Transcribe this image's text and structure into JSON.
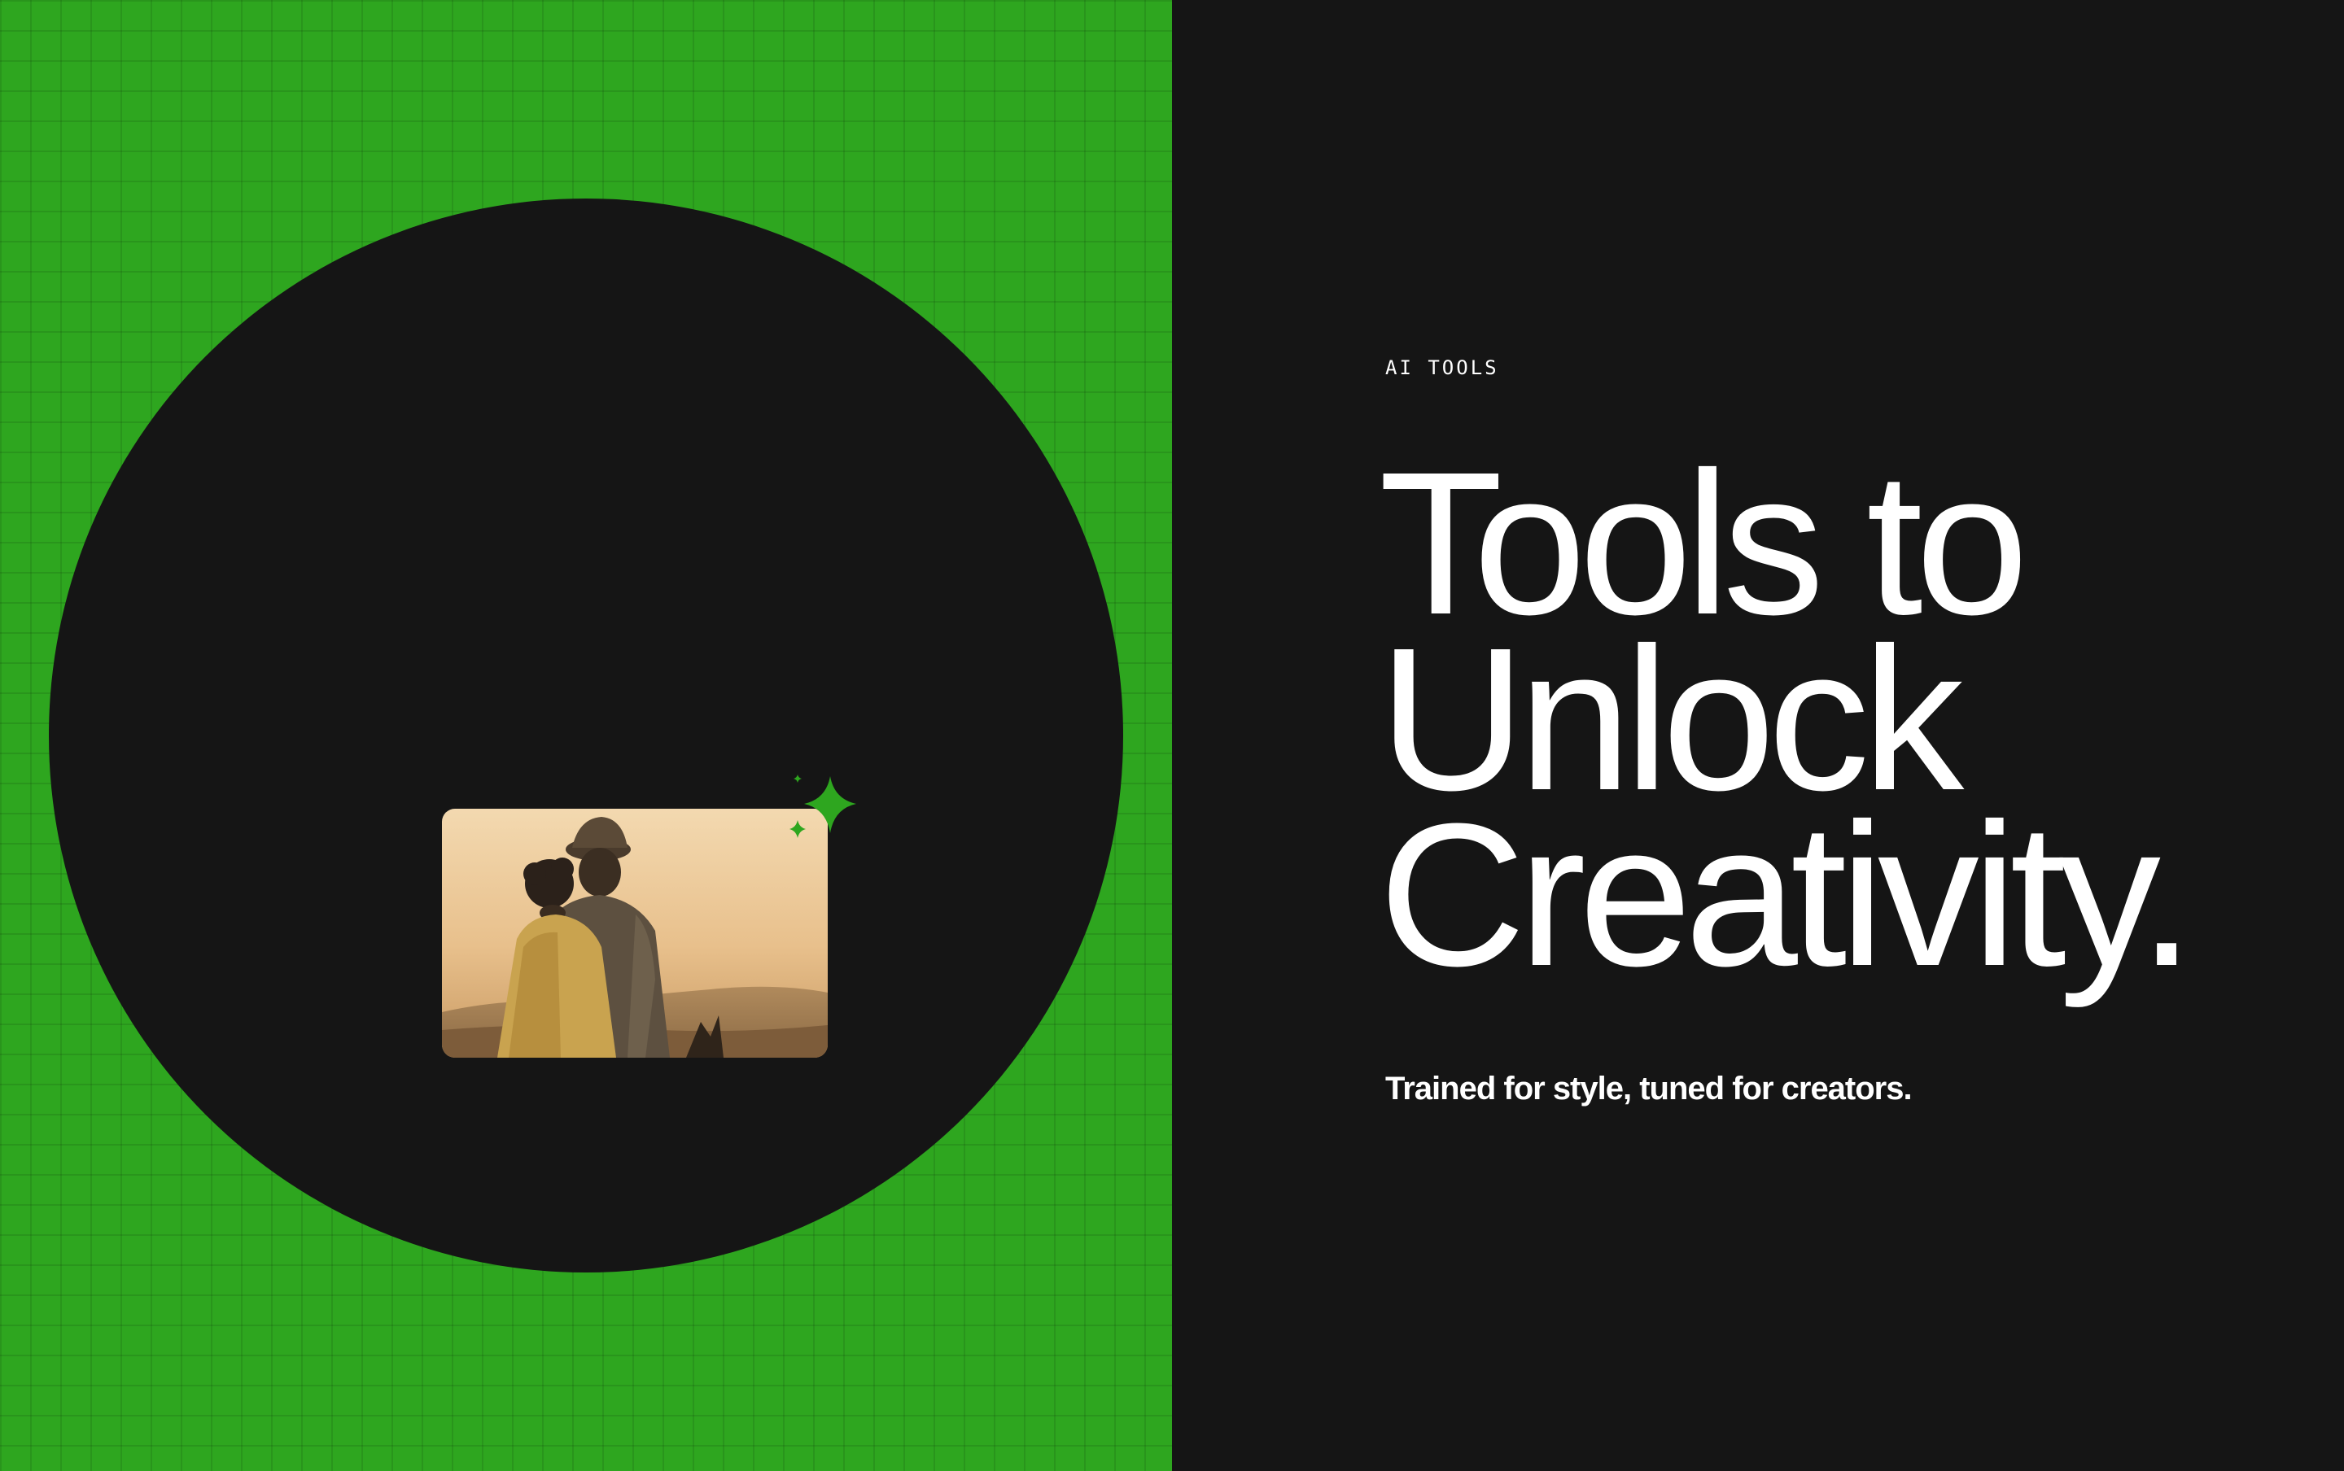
{
  "theme": {
    "accent": "#2ea61f",
    "background": "#151515",
    "text": "#ffffff"
  },
  "hero": {
    "eyebrow": "AI TOOLS",
    "headline": [
      "Tools to",
      "Unlock",
      "Creativity."
    ],
    "subtitle": "Trained for style, tuned for creators."
  },
  "media": {
    "image_label": "photo of child and adult on horseback at sunset",
    "sparkle_icon": "sparkle-icon"
  }
}
